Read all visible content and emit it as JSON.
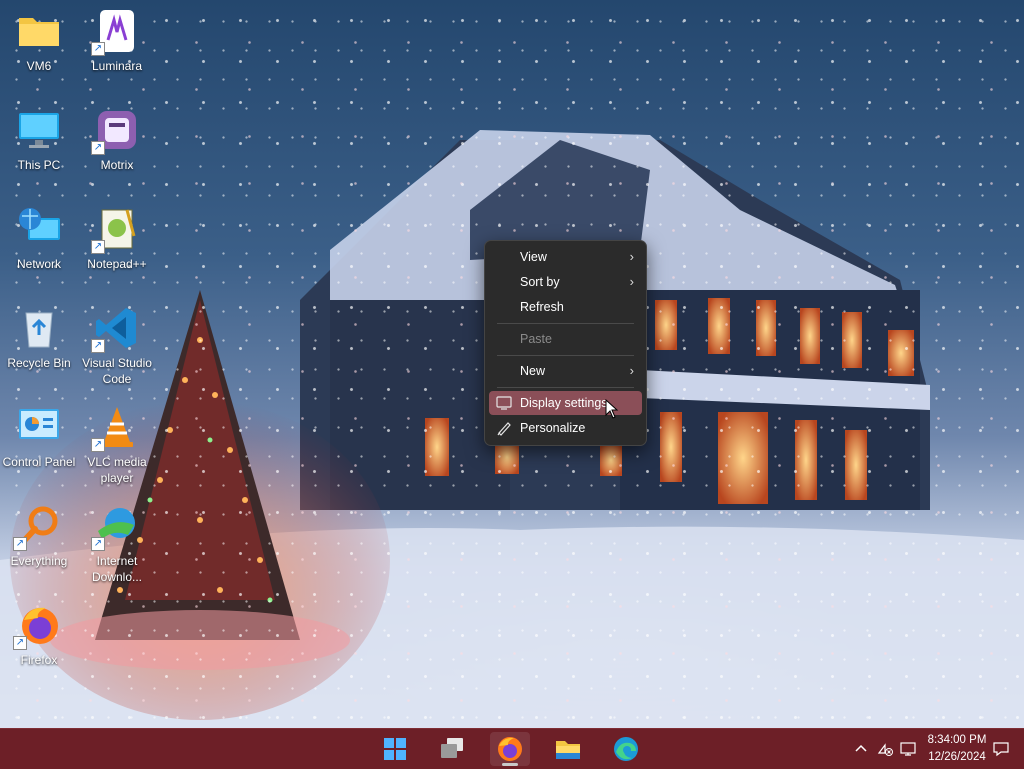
{
  "desktop": {
    "icons": [
      {
        "label": "VM6",
        "icon": "folder-icon"
      },
      {
        "label": "Luminara",
        "icon": "luminara-icon"
      },
      {
        "label": "This PC",
        "icon": "monitor-icon"
      },
      {
        "label": "Motrix",
        "icon": "motrix-icon"
      },
      {
        "label": "Network",
        "icon": "network-icon"
      },
      {
        "label": "Notepad++",
        "icon": "notepadpp-icon"
      },
      {
        "label": "Recycle Bin",
        "icon": "recycle-bin-icon"
      },
      {
        "label": "Visual Studio Code",
        "icon": "vscode-icon"
      },
      {
        "label": "Control Panel",
        "icon": "control-panel-icon"
      },
      {
        "label": "VLC media player",
        "icon": "vlc-icon"
      },
      {
        "label": "Everything",
        "icon": "everything-icon"
      },
      {
        "label": "Internet Downlo...",
        "icon": "idm-icon"
      },
      {
        "label": "Firefox",
        "icon": "firefox-icon"
      }
    ]
  },
  "context_menu": {
    "items": [
      {
        "label": "View",
        "submenu": true
      },
      {
        "label": "Sort by",
        "submenu": true
      },
      {
        "label": "Refresh"
      },
      {
        "label": "Paste",
        "disabled": true
      },
      {
        "label": "New",
        "submenu": true
      },
      {
        "label": "Display settings",
        "icon": "display-settings-icon",
        "highlighted": true
      },
      {
        "label": "Personalize",
        "icon": "personalize-icon"
      }
    ],
    "arrow_glyph": "›"
  },
  "taskbar": {
    "apps": [
      "start-icon",
      "task-view-icon",
      "firefox-icon",
      "file-explorer-icon",
      "edge-icon"
    ],
    "active_app": "firefox-icon",
    "tray_icons": [
      "chevron-up-icon",
      "network-disconnected-icon",
      "display-icon",
      "notification-icon"
    ],
    "time": "8:34:00 PM",
    "date": "12/26/2024"
  },
  "colors": {
    "taskbar": "#6d1f27",
    "menu_bg": "#2b2b2b",
    "menu_highlight": "#8b4f58"
  }
}
